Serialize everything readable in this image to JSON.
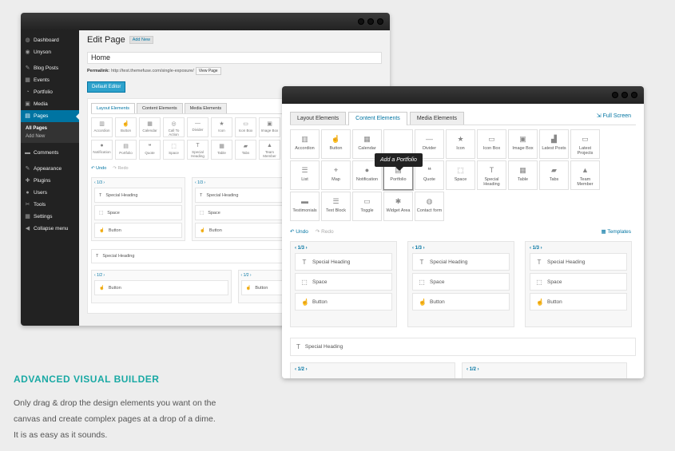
{
  "back_window": {
    "sidebar": {
      "items": [
        {
          "label": "Dashboard",
          "icon": "dashboard-icon",
          "glyph": "◍"
        },
        {
          "label": "Unyson",
          "icon": "unyson-icon",
          "glyph": "◉"
        },
        {
          "label": "Blog Posts",
          "icon": "pin-icon",
          "glyph": "✎"
        },
        {
          "label": "Events",
          "icon": "events-icon",
          "glyph": "▦"
        },
        {
          "label": "Portfolio",
          "icon": "portfolio-icon",
          "glyph": "◔"
        },
        {
          "label": "Media",
          "icon": "media-icon",
          "glyph": "▣"
        },
        {
          "label": "Pages",
          "icon": "pages-icon",
          "glyph": "▤"
        },
        {
          "label": "Comments",
          "icon": "comments-icon",
          "glyph": "▬"
        },
        {
          "label": "Appearance",
          "icon": "appearance-icon",
          "glyph": "✎"
        },
        {
          "label": "Plugins",
          "icon": "plugins-icon",
          "glyph": "✚"
        },
        {
          "label": "Users",
          "icon": "users-icon",
          "glyph": "●"
        },
        {
          "label": "Tools",
          "icon": "tools-icon",
          "glyph": "✂"
        },
        {
          "label": "Settings",
          "icon": "settings-icon",
          "glyph": "▦"
        },
        {
          "label": "Collapse menu",
          "icon": "collapse-icon",
          "glyph": "◀"
        }
      ],
      "sub_items": [
        "All Pages",
        "Add New"
      ]
    },
    "title": "Edit Page",
    "add_new": "Add New",
    "page_title_value": "Home",
    "permalink_label": "Permalink:",
    "permalink_url": "http://test.themefuse.com/single-exposure/",
    "view_page": "View Page",
    "default_editor": "Default Editor",
    "tabs": [
      "Layout Elements",
      "Content Elements",
      "Media Elements"
    ],
    "elements": [
      {
        "label": "Accordion",
        "glyph": "▥"
      },
      {
        "label": "Button",
        "glyph": "☝"
      },
      {
        "label": "Calendar",
        "glyph": "▦"
      },
      {
        "label": "Call To Action",
        "glyph": "◎"
      },
      {
        "label": "Divider",
        "glyph": "—"
      },
      {
        "label": "Icon",
        "glyph": "★"
      },
      {
        "label": "Icon Box",
        "glyph": "▭"
      },
      {
        "label": "Image Box",
        "glyph": "▣"
      },
      {
        "label": "Notification",
        "glyph": "●"
      },
      {
        "label": "Portfolio",
        "glyph": "▤"
      },
      {
        "label": "Quote",
        "glyph": "❝"
      },
      {
        "label": "Space",
        "glyph": "⬚"
      },
      {
        "label": "Special Heading",
        "glyph": "T"
      },
      {
        "label": "Table",
        "glyph": "▦"
      },
      {
        "label": "Tabs",
        "glyph": "▰"
      },
      {
        "label": "Team Member",
        "glyph": "▲"
      }
    ],
    "undo": "Undo",
    "redo": "Redo",
    "col_label_third": "1/3",
    "col_label_half": "1/2",
    "col_items": [
      "Special Heading",
      "Space",
      "Button"
    ],
    "full_item": "Special Heading",
    "half_item": "Button"
  },
  "front_window": {
    "tabs": [
      "Layout Elements",
      "Content Elements",
      "Media Elements"
    ],
    "active_tab": 1,
    "fullscreen": "Full Screen",
    "elements": [
      {
        "label": "Accordion",
        "glyph": "▥"
      },
      {
        "label": "Button",
        "glyph": "☝"
      },
      {
        "label": "Calendar",
        "glyph": "▦"
      },
      {
        "label": "",
        "glyph": ""
      },
      {
        "label": "Divider",
        "glyph": "—"
      },
      {
        "label": "Icon",
        "glyph": "★"
      },
      {
        "label": "Icon Box",
        "glyph": "▭"
      },
      {
        "label": "Image Box",
        "glyph": "▣"
      },
      {
        "label": "Latest Posts",
        "glyph": "▟"
      },
      {
        "label": "Latest Projects",
        "glyph": "▭"
      },
      {
        "label": "List",
        "glyph": "☰"
      },
      {
        "label": "Map",
        "glyph": "⌖"
      },
      {
        "label": "Notification",
        "glyph": "●"
      },
      {
        "label": "Portfolio",
        "glyph": "▤"
      },
      {
        "label": "Quote",
        "glyph": "❝"
      },
      {
        "label": "Space",
        "glyph": "⬚"
      },
      {
        "label": "Special Heading",
        "glyph": "T"
      },
      {
        "label": "Table",
        "glyph": "▦"
      },
      {
        "label": "Tabs",
        "glyph": "▰"
      },
      {
        "label": "Team Member",
        "glyph": "▲"
      },
      {
        "label": "Testimonials",
        "glyph": "▬"
      },
      {
        "label": "Text Block",
        "glyph": "☰"
      },
      {
        "label": "Toggle",
        "glyph": "▭"
      },
      {
        "label": "Widget Area",
        "glyph": "✱"
      },
      {
        "label": "Contact form",
        "glyph": "◍"
      }
    ],
    "tooltip": "Add a Portfolio",
    "undo": "Undo",
    "redo": "Redo",
    "templates": "Templates",
    "col_label_third": "1/3",
    "col_label_half": "1/2",
    "col_items": [
      "Special Heading",
      "Space",
      "Button"
    ],
    "full_item": "Special Heading"
  },
  "headline": "ADVANCED VISUAL BUILDER",
  "description_lines": [
    "Only drag & drop the design elements you want on the",
    "canvas and create complex pages at a drop of a dime.",
    "It is as easy as it sounds."
  ],
  "colors": {
    "accent": "#19a9a4",
    "wp_blue": "#0074a2",
    "button_blue": "#2ea2cc"
  }
}
